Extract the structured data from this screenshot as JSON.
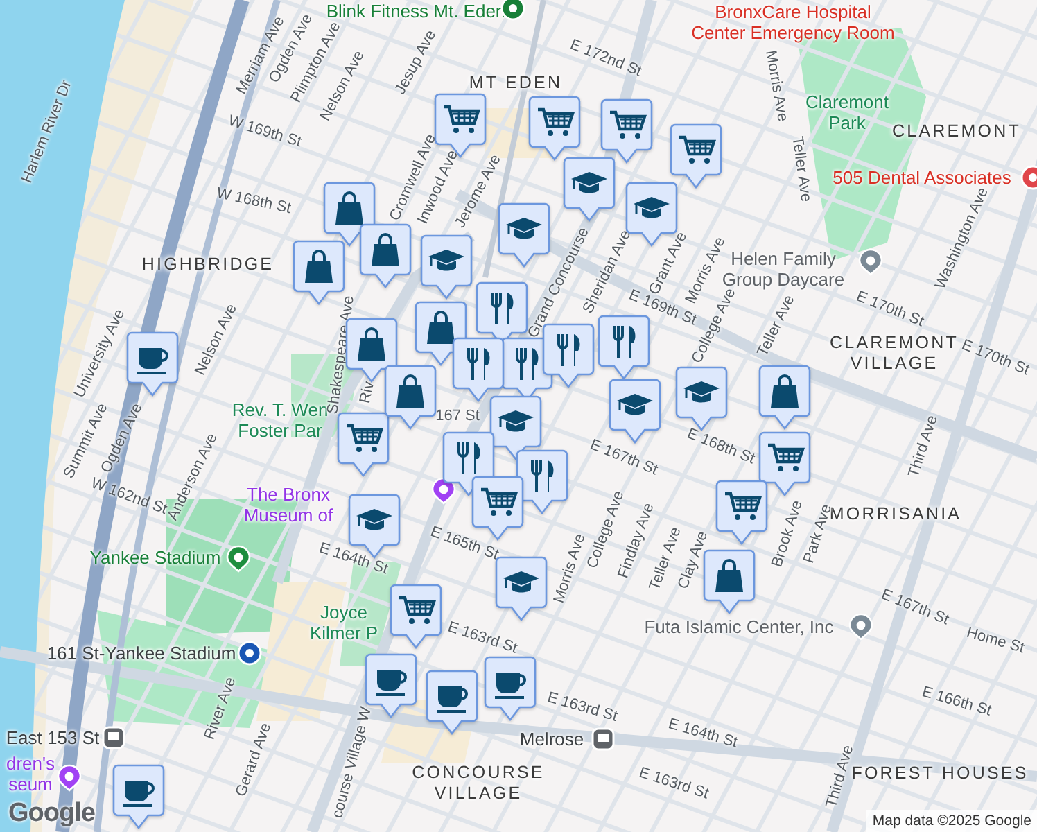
{
  "neighborhoods": [
    {
      "lines": [
        "MT EDEN"
      ]
    },
    {
      "lines": [
        "HIGHBRIDGE"
      ]
    },
    {
      "lines": [
        "CLAREMONT"
      ]
    },
    {
      "lines": [
        "CLAREMONT",
        "VILLAGE"
      ]
    },
    {
      "lines": [
        "MORRISANIA"
      ]
    },
    {
      "lines": [
        "CONCOURSE",
        "VILLAGE"
      ]
    },
    {
      "lines": [
        "FOREST HOUSES"
      ]
    }
  ],
  "places": [
    {
      "kind": "fitness",
      "lines": [
        "Blink Fitness Mt. Eden"
      ]
    },
    {
      "kind": "hospital",
      "lines": [
        "BronxCare Hospital",
        "Center Emergency Room"
      ]
    },
    {
      "kind": "park",
      "lines": [
        "Claremont",
        "Park"
      ]
    },
    {
      "kind": "medical",
      "lines": [
        "505 Dental Associates"
      ]
    },
    {
      "kind": "daycare",
      "lines": [
        "Helen Family",
        "Group Daycare"
      ]
    },
    {
      "kind": "park",
      "lines": [
        "Rev. T. Wen",
        "Foster Par"
      ]
    },
    {
      "kind": "museum",
      "lines": [
        "The Bronx",
        "Museum of"
      ]
    },
    {
      "kind": "stadium",
      "lines": [
        "Yankee Stadium"
      ]
    },
    {
      "kind": "park",
      "lines": [
        "Joyce",
        "Kilmer P"
      ]
    },
    {
      "kind": "subway",
      "lines": [
        "161 St-Yankee Stadium"
      ]
    },
    {
      "kind": "train",
      "lines": [
        "East 153 St"
      ]
    },
    {
      "kind": "museum",
      "lines": [
        "dren's",
        "seum"
      ]
    },
    {
      "kind": "train",
      "lines": [
        "Melrose"
      ]
    },
    {
      "kind": "worship",
      "lines": [
        "Futa Islamic Center, Inc"
      ]
    }
  ],
  "streets": [
    "Harlem River Dr",
    "Merriam Ave",
    "Ogden Ave",
    "Plimpton Ave",
    "Nelson Ave",
    "Jesup Ave",
    "W 169th St",
    "W 168th St",
    "Cromwell Ave",
    "Inwood Ave",
    "Jerome Ave",
    "E 172nd St",
    "Morris Ave",
    "Teller Ave",
    "Sheridan Ave",
    "Grand Concourse",
    "Grant Ave",
    "Morris Ave",
    "College Ave",
    "Teller Ave",
    "E 169th St",
    "E 170th St",
    "Washington Ave",
    "E 170th St",
    "Shakespeare Ave",
    "University Ave",
    "Nelson Ave",
    "Ogden Ave",
    "Summit Ave",
    "Anderson Ave",
    "W 162nd St",
    "E 164th St",
    "E 165th St",
    "167 St",
    "E 167th St",
    "E 168th St",
    "College Ave",
    "Findlay Ave",
    "Teller Ave",
    "Clay Ave",
    "Brook Ave",
    "Park Ave",
    "Third Ave",
    "E 167th St",
    "Home St",
    "E 166th St",
    "E 163rd St",
    "E 164th St",
    "E 163rd St",
    "Third Ave",
    "River Ave",
    "Gerard Ave",
    "E 163rd St",
    "course Village W",
    "Morris Ave",
    "Riv"
  ],
  "markers": [
    {
      "kind": "cart"
    },
    {
      "kind": "cart"
    },
    {
      "kind": "cart"
    },
    {
      "kind": "cart"
    },
    {
      "kind": "cart"
    },
    {
      "kind": "bag"
    },
    {
      "kind": "bag"
    },
    {
      "kind": "bag"
    },
    {
      "kind": "bag"
    },
    {
      "kind": "bag"
    },
    {
      "kind": "bag"
    },
    {
      "kind": "cap"
    },
    {
      "kind": "cap"
    },
    {
      "kind": "cap"
    },
    {
      "kind": "cap"
    },
    {
      "kind": "food"
    },
    {
      "kind": "food"
    },
    {
      "kind": "food"
    },
    {
      "kind": "food"
    },
    {
      "kind": "food"
    },
    {
      "kind": "cap"
    },
    {
      "kind": "cap"
    },
    {
      "kind": "bag"
    },
    {
      "kind": "cart"
    },
    {
      "kind": "cart"
    },
    {
      "kind": "cap"
    },
    {
      "kind": "food"
    },
    {
      "kind": "food"
    },
    {
      "kind": "cart"
    },
    {
      "kind": "cup"
    },
    {
      "kind": "cap"
    },
    {
      "kind": "cart"
    },
    {
      "kind": "cap"
    },
    {
      "kind": "bag"
    },
    {
      "kind": "cup"
    },
    {
      "kind": "cup"
    },
    {
      "kind": "cup"
    },
    {
      "kind": "cup"
    }
  ],
  "footer": {
    "logo": "Google",
    "attribution": "Map data ©2025 Google"
  }
}
